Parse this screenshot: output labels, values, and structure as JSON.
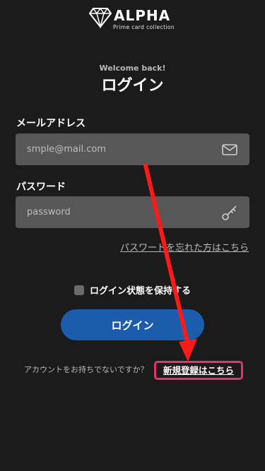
{
  "brand": {
    "name": "ALPHA",
    "tagline": "Prime card collection"
  },
  "header": {
    "welcome": "Welcome back!",
    "title": "ログイン"
  },
  "form": {
    "email": {
      "label": "メールアドレス",
      "placeholder": "smple@mail.com",
      "value": "",
      "icon": "mail-icon"
    },
    "password": {
      "label": "パスワード",
      "placeholder": "password",
      "value": "",
      "icon": "key-icon"
    },
    "forgot_link": "パスワードを忘れた方はこちら",
    "remember_label": "ログイン状態を保持する",
    "remember_checked": false,
    "submit_label": "ログイン"
  },
  "footer": {
    "prompt": "アカウントをお持ちでないですか？",
    "signup_link": "新規登録はこちら"
  },
  "colors": {
    "background": "#1b1b1b",
    "input_bg": "#575757",
    "primary": "#1c5cad",
    "annotation_red": "#ff1a1a",
    "annotation_box": "#e5326e"
  }
}
